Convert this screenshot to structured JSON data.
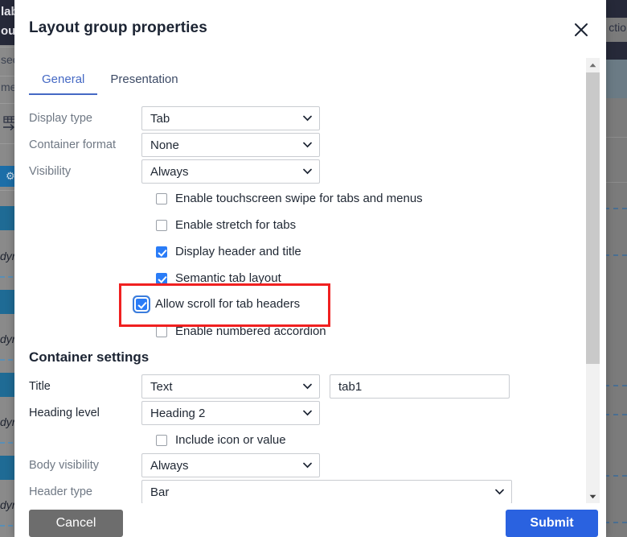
{
  "background": {
    "left_strip_texts": [
      "lab",
      "out",
      "sec",
      "met",
      "dyn",
      "dyn",
      "dyn",
      "dyn"
    ],
    "right_strip_text": "ctio",
    "gear_icon": "gear-icon",
    "table_icon": "table-insert-icon"
  },
  "dialog": {
    "title": "Layout group properties",
    "close_icon": "close-icon",
    "tabs": [
      {
        "label": "General",
        "active": true
      },
      {
        "label": "Presentation",
        "active": false
      }
    ],
    "general": {
      "fields": [
        {
          "label": "Display type",
          "value": "Tab",
          "control": "select"
        },
        {
          "label": "Container format",
          "value": "None",
          "control": "select"
        },
        {
          "label": "Visibility",
          "value": "Always",
          "control": "select"
        }
      ],
      "checkboxes": [
        {
          "label": "Enable touchscreen swipe for tabs and menus",
          "checked": false
        },
        {
          "label": "Enable stretch for tabs",
          "checked": false
        },
        {
          "label": "Display header and title",
          "checked": true
        },
        {
          "label": "Semantic tab layout",
          "checked": true
        },
        {
          "label": "Allow scroll for tab headers",
          "checked": true,
          "focused": true
        },
        {
          "label": "Enable numbered accordion",
          "checked": false
        }
      ]
    },
    "container_settings": {
      "heading": "Container settings",
      "title_label": "Title",
      "title_select": "Text",
      "title_text": "tab1",
      "heading_level_label": "Heading level",
      "heading_level_value": "Heading 2",
      "include_icon_label": "Include icon or value",
      "include_icon_checked": false,
      "body_visibility_label": "Body visibility",
      "body_visibility_value": "Always",
      "header_type_label": "Header type",
      "header_type_value": "Bar"
    },
    "scrollbar": {
      "up_arrow_icon": "scroll-up-arrow-icon",
      "down_arrow_icon": "scroll-down-arrow-icon"
    },
    "footer": {
      "cancel_label": "Cancel",
      "submit_label": "Submit"
    }
  },
  "annotation": {
    "highlight_label": "Allow scroll for tab headers",
    "highlight_checked": true,
    "color": "#f02020"
  }
}
